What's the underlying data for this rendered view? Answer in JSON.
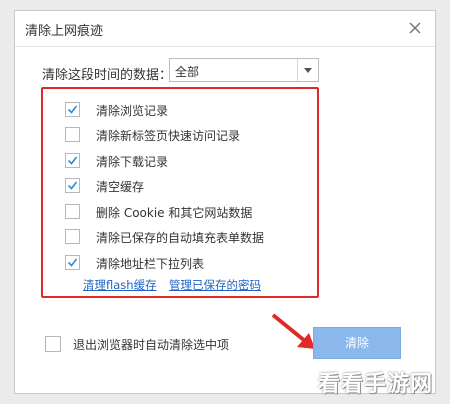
{
  "dialog": {
    "title": "清除上网痕迹"
  },
  "range": {
    "label": "清除这段时间的数据：",
    "selected": "全部"
  },
  "options": [
    {
      "label": "清除浏览记录",
      "checked": true
    },
    {
      "label": "清除新标签页快速访问记录",
      "checked": false
    },
    {
      "label": "清除下载记录",
      "checked": true
    },
    {
      "label": "清空缓存",
      "checked": true
    },
    {
      "label": "删除 Cookie 和其它网站数据",
      "checked": false
    },
    {
      "label": "清除已保存的自动填充表单数据",
      "checked": false
    },
    {
      "label": "清除地址栏下拉列表",
      "checked": true
    }
  ],
  "links": {
    "flash": "清理flash缓存",
    "passwords": "管理已保存的密码"
  },
  "footer": {
    "auto_clear_label": "退出浏览器时自动清除选中项",
    "auto_clear_checked": false,
    "clear_button": "清除"
  },
  "watermark": "看看手游网",
  "colors": {
    "highlight_border": "#e02a2a",
    "link": "#1f63c6",
    "button": "#8ab7ec"
  }
}
